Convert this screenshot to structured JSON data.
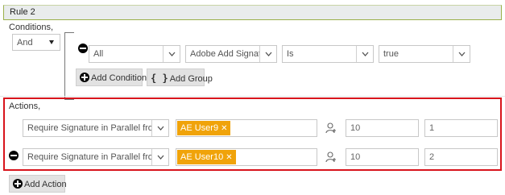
{
  "rule": {
    "title": "Rule 2"
  },
  "conditions": {
    "label": "Conditions,",
    "operator": "And",
    "row": {
      "scope": "All",
      "field": "Adobe Add Signature",
      "comparator": "Is",
      "value": "true"
    },
    "add_condition_label": "Add Condition",
    "add_group_label": "Add Group"
  },
  "actions": {
    "label": "Actions,",
    "rows": [
      {
        "action": "Require Signature in Parallel from",
        "user_tag": "AE User9",
        "value1": "10",
        "value2": "1"
      },
      {
        "action": "Require Signature in Parallel from",
        "user_tag": "AE User10",
        "value1": "10",
        "value2": "2"
      }
    ],
    "add_action_label": "Add Action"
  },
  "colors": {
    "tag": "#f0a30a",
    "highlight_border": "#d8141c",
    "rule_header_border": "#9ab04a"
  },
  "icons": [
    "minus-circle-icon",
    "plus-circle-icon",
    "braces-icon",
    "chevron-down-icon",
    "user-lookup-icon",
    "tag-remove-icon"
  ]
}
